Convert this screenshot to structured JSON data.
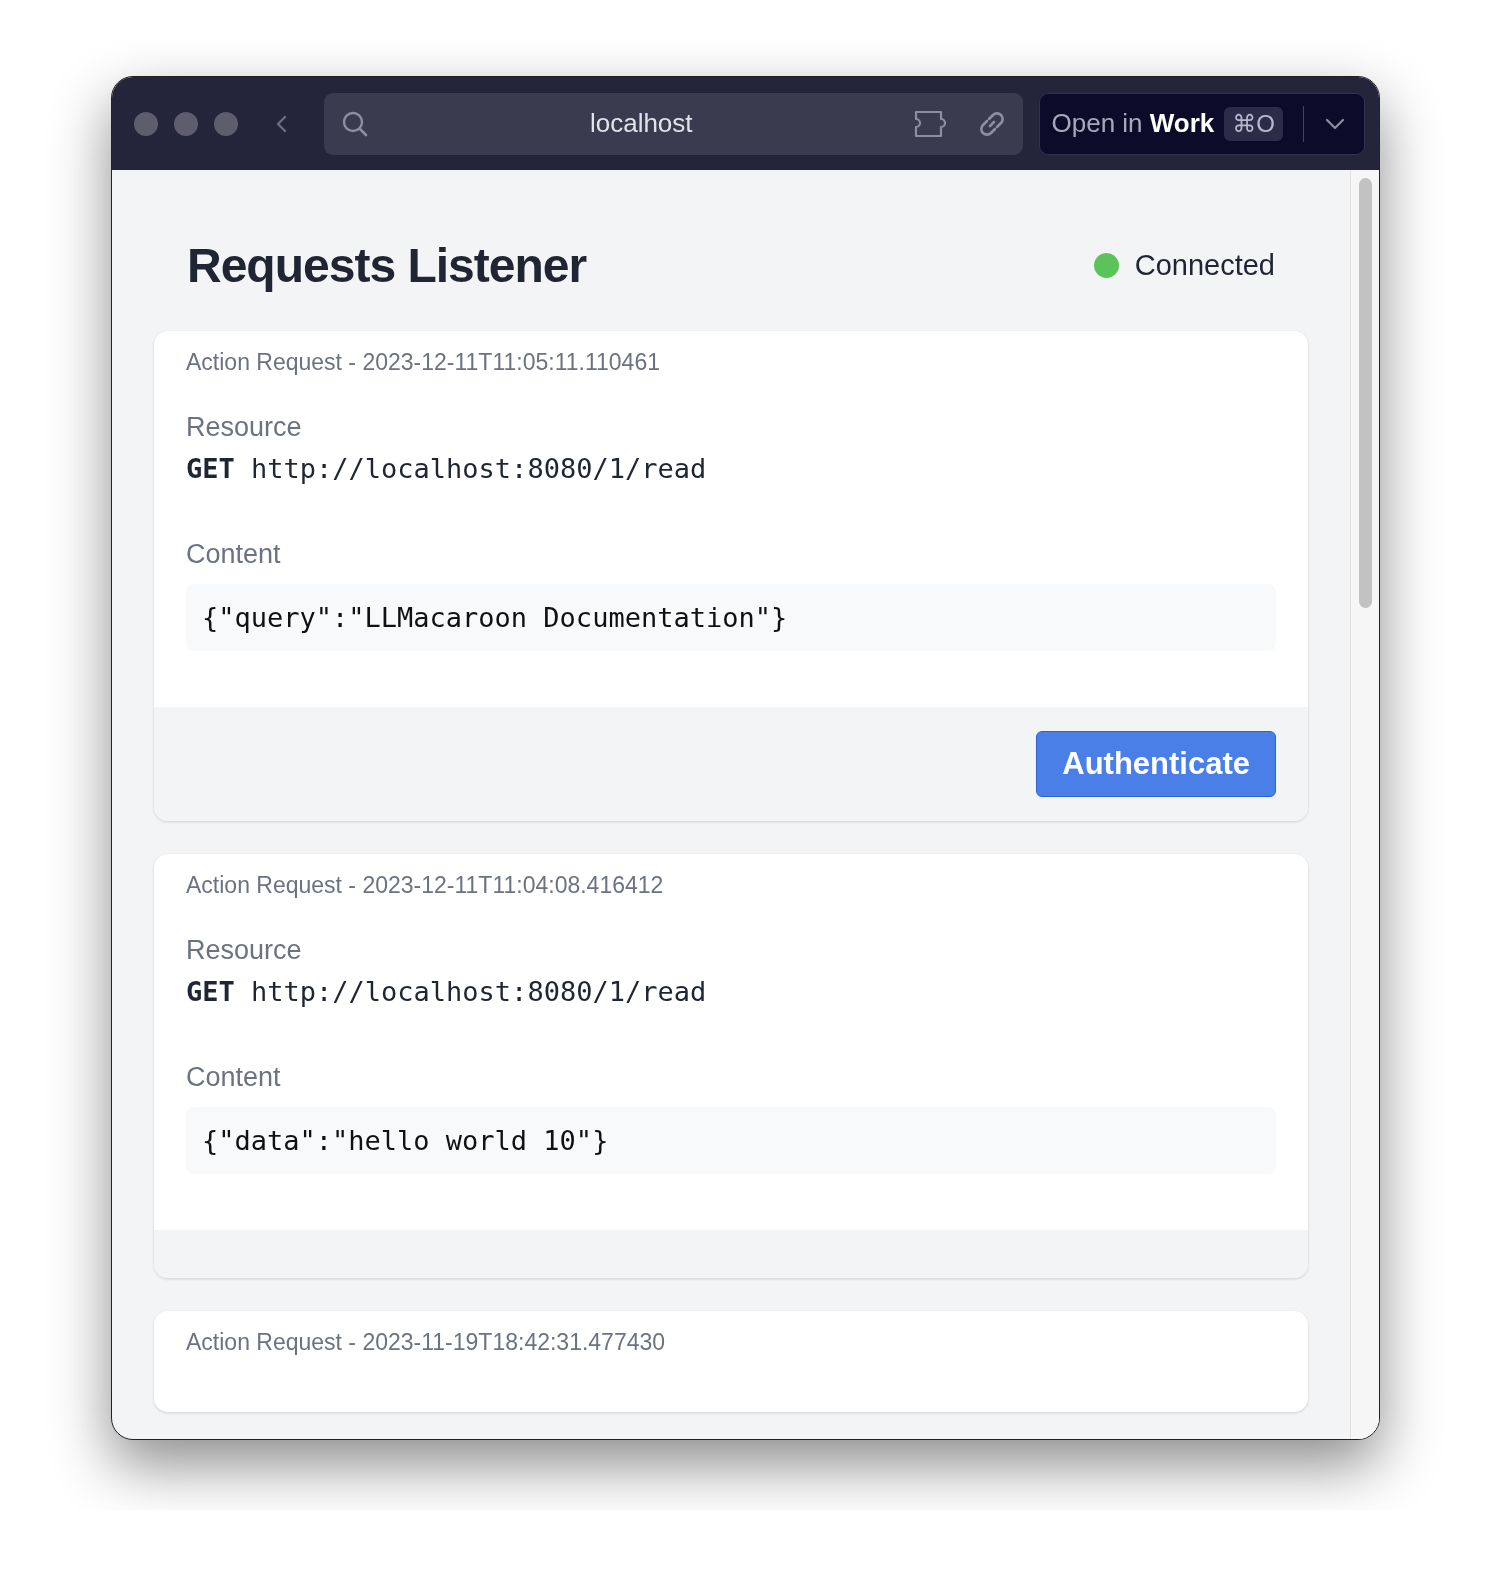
{
  "browser": {
    "address": "localhost",
    "open_button": "Open in **Work**",
    "shortcut": "⌘O"
  },
  "page": {
    "title": "Requests Listener",
    "status": {
      "label": "Connected",
      "connected": true
    }
  },
  "requests": [
    {
      "title": "Action Request - 2023-12-11T11:05:11.110461",
      "resource_label": "Resource",
      "method": "GET",
      "url": "http://localhost:8080/1/read",
      "content_label": "Content",
      "content": "{\"query\":\"LLMacaroon Documentation\"}",
      "action": "Authenticate"
    },
    {
      "title": "Action Request - 2023-12-11T11:04:08.416412",
      "resource_label": "Resource",
      "method": "GET",
      "url": "http://localhost:8080/1/read",
      "content_label": "Content",
      "content": "{\"data\":\"hello world 10\"}"
    },
    {
      "title": "Action Request - 2023-11-19T18:42:31.477430"
    }
  ]
}
